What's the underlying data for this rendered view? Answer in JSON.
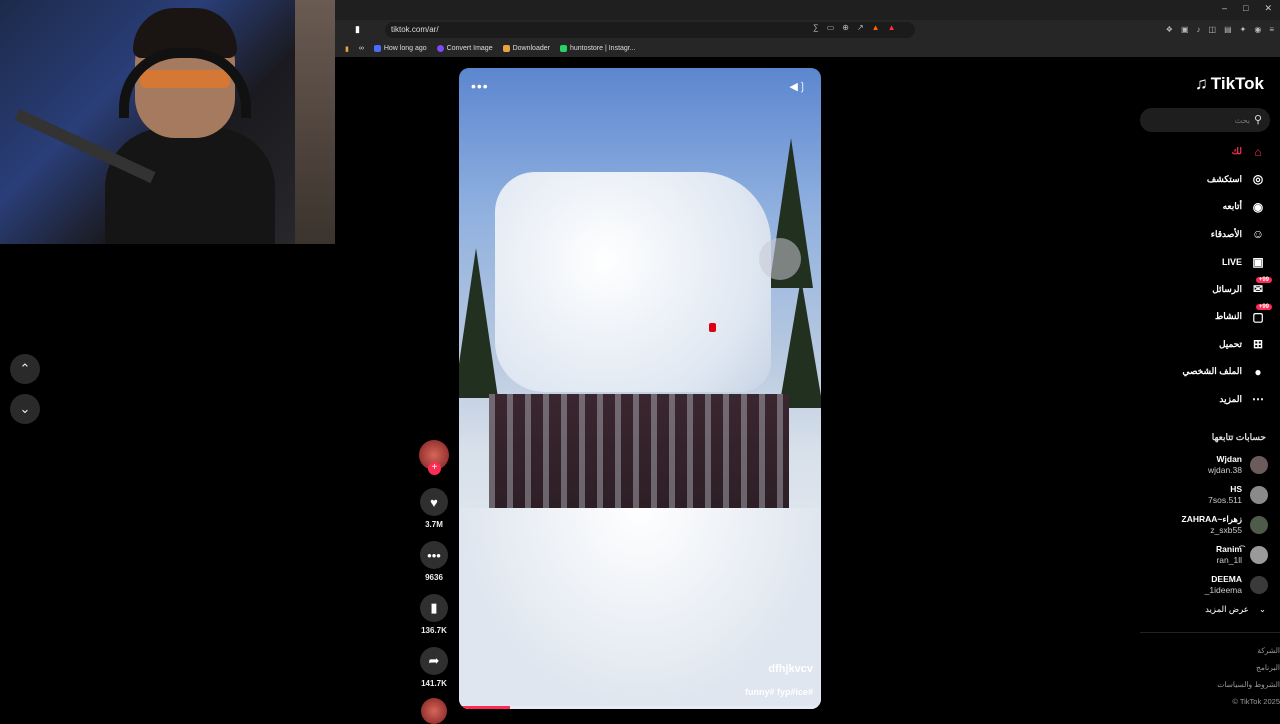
{
  "browser": {
    "url": "tiktok.com/ar/",
    "bookmarks": [
      "How long ago",
      "Convert Image",
      "Downloader",
      "huntostore | Instagr..."
    ],
    "window_controls": [
      "–",
      "□",
      "✕"
    ]
  },
  "nav": {
    "up_icon": "chevron-up-icon",
    "down_icon": "chevron-down-icon"
  },
  "video": {
    "author": "dfhjkvcv",
    "hashtags": "funny# fyp#ice#",
    "progress": 0.14
  },
  "actions": {
    "likes": "3.7M",
    "comments": "9636",
    "saves": "136.7K",
    "shares": "141.7K"
  },
  "sidebar": {
    "logo": "TikTok",
    "search_placeholder": "بحث",
    "menu": [
      {
        "label": "لك",
        "icon": "home-icon",
        "glyph": "⌂",
        "active": true
      },
      {
        "label": "استكشف",
        "icon": "compass-icon",
        "glyph": "◎"
      },
      {
        "label": "أتابعه",
        "icon": "following-icon",
        "glyph": "◉"
      },
      {
        "label": "الأصدقاء",
        "icon": "friends-icon",
        "glyph": "☺"
      },
      {
        "label": "LIVE",
        "icon": "live-icon",
        "glyph": "▣"
      },
      {
        "label": "الرسائل",
        "icon": "messages-icon",
        "glyph": "✉",
        "badge": "+99"
      },
      {
        "label": "النشاط",
        "icon": "activity-icon",
        "glyph": "▢",
        "badge": "+99"
      },
      {
        "label": "تحميل",
        "icon": "upload-icon",
        "glyph": "⊞"
      },
      {
        "label": "الملف الشخصي",
        "icon": "profile-icon",
        "glyph": "●"
      },
      {
        "label": "المزيد",
        "icon": "more-icon",
        "glyph": "⋯"
      }
    ],
    "following_title": "حسابات تتابعها",
    "accounts": [
      {
        "name": "Wjdan",
        "handle": "wjdan.38"
      },
      {
        "name": "HS",
        "handle": "7sos.511"
      },
      {
        "name": "ZAHRAA~زهراء",
        "handle": "z_sxb55"
      },
      {
        "name": "Ranim‎͡",
        "handle": "ran_1ll"
      },
      {
        "name": "DEEMA",
        "handle": "_1ideema"
      }
    ],
    "see_more": "عرض المزيد",
    "footer": [
      "الشركة",
      "البرنامج",
      "الشروط والسياسات",
      "© TikTok 2025"
    ]
  }
}
